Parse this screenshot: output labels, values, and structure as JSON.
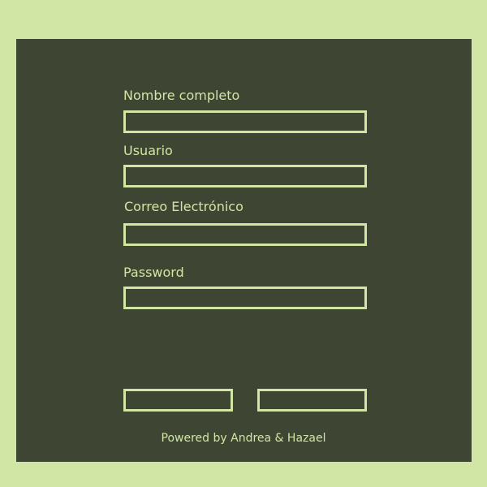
{
  "form": {
    "fields": [
      {
        "label": "Nombre completo",
        "value": "",
        "placeholder": ""
      },
      {
        "label": "Usuario",
        "value": "",
        "placeholder": ""
      },
      {
        "label": "Correo Electrónico",
        "value": "",
        "placeholder": ""
      },
      {
        "label": "Password",
        "value": "",
        "placeholder": ""
      }
    ],
    "buttons": [
      {
        "label": ""
      },
      {
        "label": ""
      }
    ]
  },
  "footer": {
    "text": "Powered by Andrea & Hazael"
  },
  "colors": {
    "background": "#d1e6a4",
    "panel": "#3e4533",
    "accent": "#d1e6a4"
  }
}
